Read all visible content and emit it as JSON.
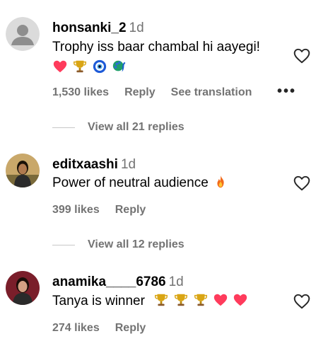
{
  "comments": [
    {
      "username": "honsanki_2",
      "time": "1d",
      "text": "Trophy iss baar chambal hi aayegi!",
      "emojis": [
        "heart-icon",
        "trophy-icon",
        "nazar-icon",
        "peacock-icon"
      ],
      "likes": "1,530 likes",
      "reply": "Reply",
      "translation": "See translation",
      "more": "•••",
      "view_replies": "View all 21 replies"
    },
    {
      "username": "editxaashi",
      "time": "1d",
      "text": "Power of neutral audience",
      "emojis": [
        "fire-icon"
      ],
      "likes": "399 likes",
      "reply": "Reply",
      "view_replies": "View all 12 replies"
    },
    {
      "username": "anamika____6786",
      "time": "1d",
      "text": "Tanya is winner",
      "emojis": [
        "trophy-icon",
        "trophy-icon",
        "trophy-icon",
        "heart-icon",
        "heart-icon"
      ],
      "likes": "274 likes",
      "reply": "Reply"
    }
  ],
  "colors": {
    "secondary_text": "#737373",
    "heart": "#ff3b5c",
    "trophy": "#d9a514"
  }
}
